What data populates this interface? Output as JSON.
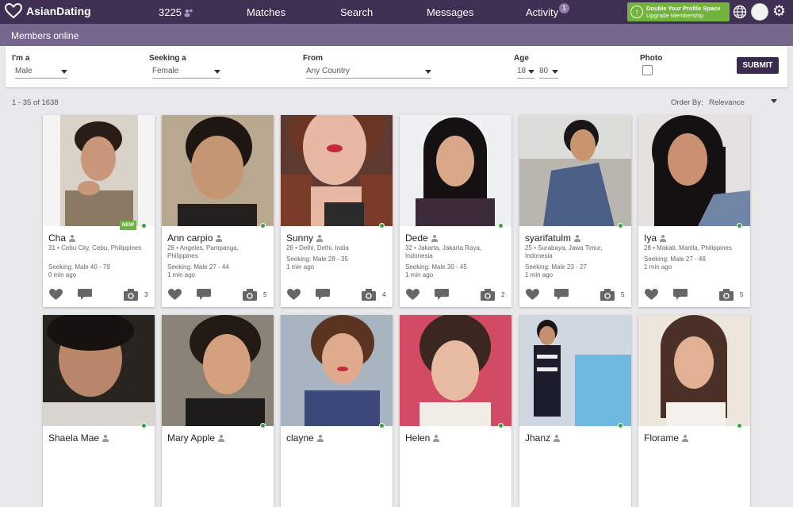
{
  "brand": {
    "name": "AsianDating"
  },
  "topnav": {
    "count": "3225",
    "matches": "Matches",
    "search": "Search",
    "messages": "Messages",
    "activity": "Activity",
    "activity_badge": "1",
    "upgrade_line1": "Double Your Profile Space",
    "upgrade_line2": "Upgrade Membership"
  },
  "subhead": {
    "title": "Members online"
  },
  "filter": {
    "im_a_label": "I'm a",
    "im_a_value": "Male",
    "seeking_label": "Seeking a",
    "seeking_value": "Female",
    "from_label": "From",
    "from_value": "Any Country",
    "age_label": "Age",
    "age_min": "18",
    "age_max": "80",
    "photo_label": "Photo",
    "submit": "SUBMIT"
  },
  "results": {
    "range": "1 - 35 of 1638",
    "order_by_label": "Order By:",
    "order_by_value": "Relevance"
  },
  "profiles": [
    {
      "name": "Cha",
      "location": "31 • Cebu City, Cebu, Philippines",
      "seeking": "Seeking: Male 40 - 79",
      "ago": "0 min ago",
      "photos": "3",
      "new": "NEW"
    },
    {
      "name": "Ann carpio",
      "location": "28 • Angeles, Pampanga, Philippines",
      "seeking": "Seeking: Male 27 - 44",
      "ago": "1 min ago",
      "photos": "5"
    },
    {
      "name": "Sunny",
      "location": "26 • Delhi, Delhi, India",
      "seeking": "Seeking: Male 28 - 35",
      "ago": "1 min ago",
      "photos": "4"
    },
    {
      "name": "Dede",
      "location": "32 • Jakarta, Jakarta Raya, Indonesia",
      "seeking": "Seeking: Male 30 - 45",
      "ago": "1 min ago",
      "photos": "2"
    },
    {
      "name": "syarifatulm",
      "location": "25 • Surabaya, Jawa Timur, Indonesia",
      "seeking": "Seeking: Male 23 - 27",
      "ago": "1 min ago",
      "photos": "5"
    },
    {
      "name": "Iya",
      "location": "28 • Makati, Manila, Philippines",
      "seeking": "Seeking: Male 27 - 46",
      "ago": "1 min ago",
      "photos": "5"
    },
    {
      "name": "Shaela Mae"
    },
    {
      "name": "Mary Apple"
    },
    {
      "name": "clayne"
    },
    {
      "name": "Helen"
    },
    {
      "name": "Jhanz"
    },
    {
      "name": "Florame"
    }
  ],
  "colors": {
    "nav": "#3f2f52",
    "subhead": "#76668d",
    "upgrade": "#71b33c",
    "online": "#3aa23f"
  }
}
